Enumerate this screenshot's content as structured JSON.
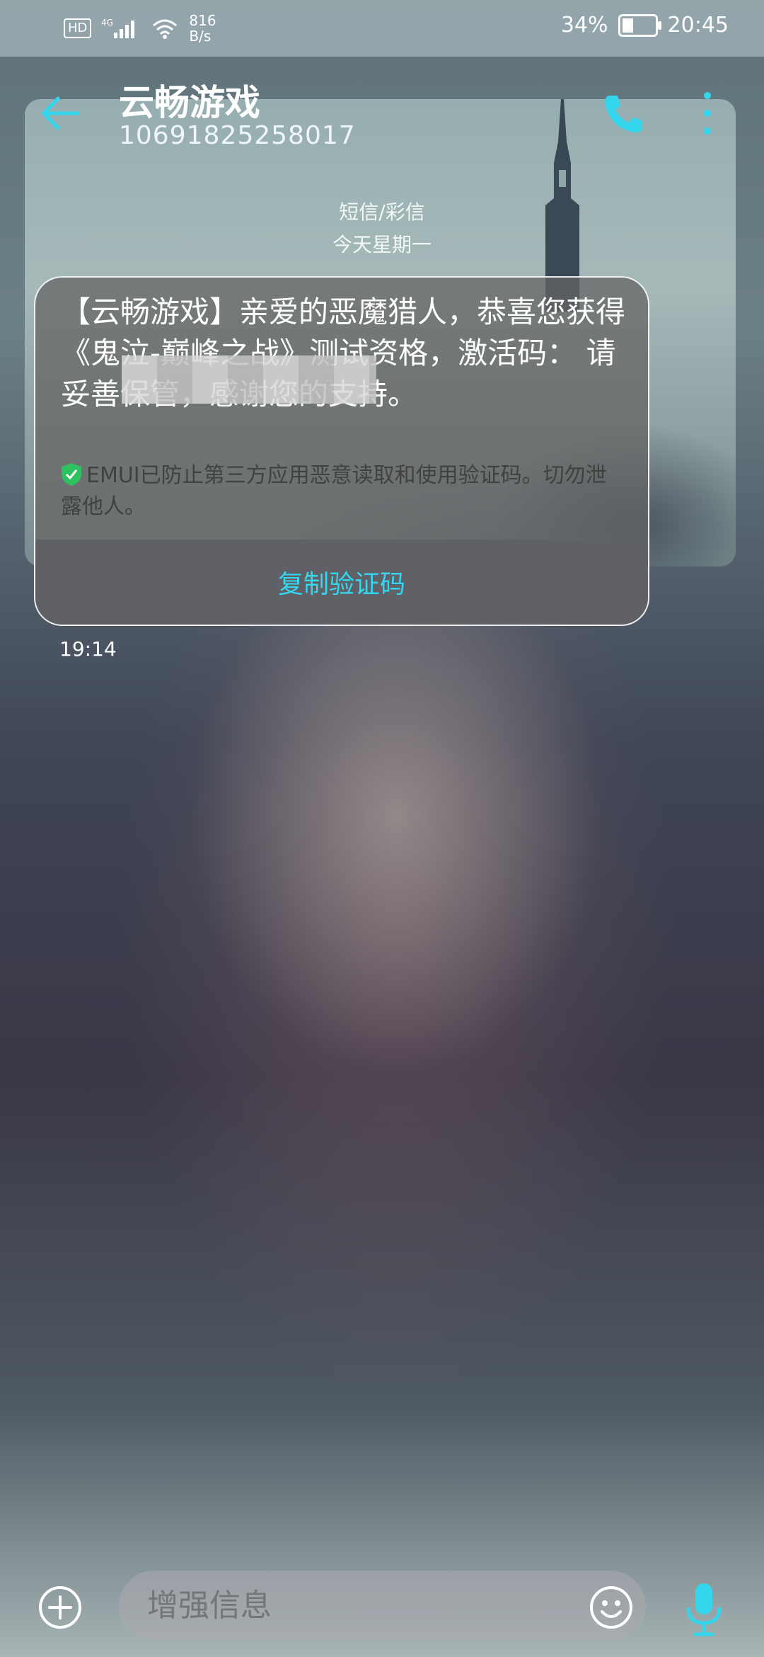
{
  "status_bar": {
    "hd": "HD",
    "network_type": "4G",
    "speed_value": "816",
    "speed_unit": "B/s",
    "battery_level": "34%",
    "battery_fraction": 0.34,
    "time": "20:45"
  },
  "header": {
    "contact_name": "云畅游戏",
    "phone_number": "10691825258017"
  },
  "thread": {
    "channel": "短信/彩信",
    "day": "今天星期一"
  },
  "message": {
    "body": "【云畅游戏】亲爱的恶魔猎人，恭喜您获得《鬼泣-巅峰之战》测试资格，激活码：                                  请妥善保管，感谢您的支持。",
    "security_notice": "EMUI已防止第三方应用恶意读取和使用验证码。切勿泄露他人。",
    "copy_button": "复制验证码",
    "time": "19:14"
  },
  "composer": {
    "placeholder": "增强信息"
  },
  "colors": {
    "accent": "#34d6ee",
    "shield_green": "#2ec15f"
  },
  "icons": {
    "back": "arrow-left-icon",
    "call": "phone-icon",
    "more": "more-vertical-icon",
    "add": "plus-circle-icon",
    "emoji": "smiley-icon",
    "mic": "microphone-icon",
    "shield": "shield-check-icon"
  }
}
